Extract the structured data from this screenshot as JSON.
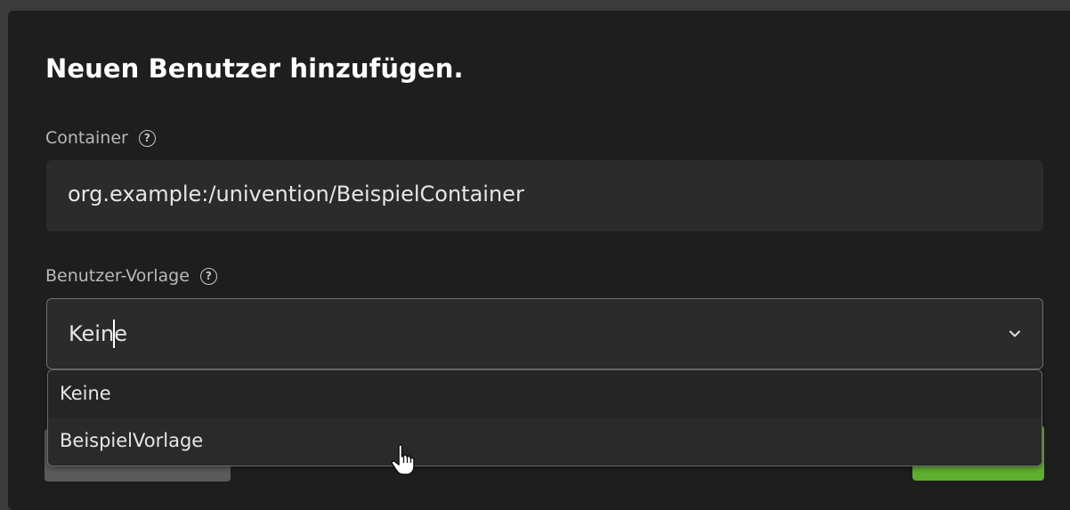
{
  "dialog": {
    "title": "Neuen Benutzer hinzufügen."
  },
  "container_field": {
    "label": "Container",
    "help_icon": "help-circle-icon",
    "value": "org.example:/univention/BeispielContainer"
  },
  "template_field": {
    "label": "Benutzer-Vorlage",
    "help_icon": "help-circle-icon",
    "value": "Keine",
    "dropdown_icon": "chevron-down-icon",
    "options": [
      {
        "label": "Keine"
      },
      {
        "label": "BeispielVorlage"
      }
    ]
  },
  "colors": {
    "dialog_bg": "#1e1e1e",
    "input_bg": "#2b2b2b",
    "primary_button": "#5fae2f",
    "secondary_button": "#5a5a5a"
  }
}
